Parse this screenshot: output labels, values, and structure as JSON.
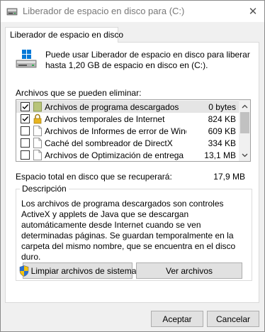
{
  "window": {
    "title": "Liberador de espacio en disco para  (C:)"
  },
  "tab": {
    "label": "Liberador de espacio en disco"
  },
  "intro": {
    "text": "Puede usar Liberador de espacio en disco para liberar hasta 1,20 GB de espacio en disco en  (C:)."
  },
  "files": {
    "label": "Archivos que se pueden eliminar:",
    "items": [
      {
        "name": "Archivos de programa descargados",
        "size": "0 bytes",
        "checked": true,
        "icon": "folder-icon",
        "selected": true
      },
      {
        "name": "Archivos temporales de Internet",
        "size": "824 KB",
        "checked": true,
        "icon": "lock-icon",
        "selected": false
      },
      {
        "name": "Archivos de Informes de error de Wind...",
        "size": "609 KB",
        "checked": false,
        "icon": "file-icon",
        "selected": false
      },
      {
        "name": "Caché del sombreador de DirectX",
        "size": "334 KB",
        "checked": false,
        "icon": "file-icon",
        "selected": false
      },
      {
        "name": "Archivos de Optimización de entrega",
        "size": "13,1 MB",
        "checked": false,
        "icon": "file-icon",
        "selected": false
      }
    ]
  },
  "total": {
    "label": "Espacio total en disco que se recuperará:",
    "value": "17,9 MB"
  },
  "description": {
    "title": "Descripción",
    "text": "Los archivos de programa descargados son controles ActiveX y applets de Java que se descargan automáticamente desde Internet cuando se ven determinadas páginas. Se guardan temporalmente en la carpeta del mismo nombre, que se encuentra en el disco duro."
  },
  "buttons": {
    "clean_system": "Limpiar archivos de sistema",
    "view_files": "Ver archivos",
    "ok": "Aceptar",
    "cancel": "Cancelar"
  },
  "colors": {
    "accent": "#0078d7",
    "selected_row": "#e5e5e5"
  }
}
